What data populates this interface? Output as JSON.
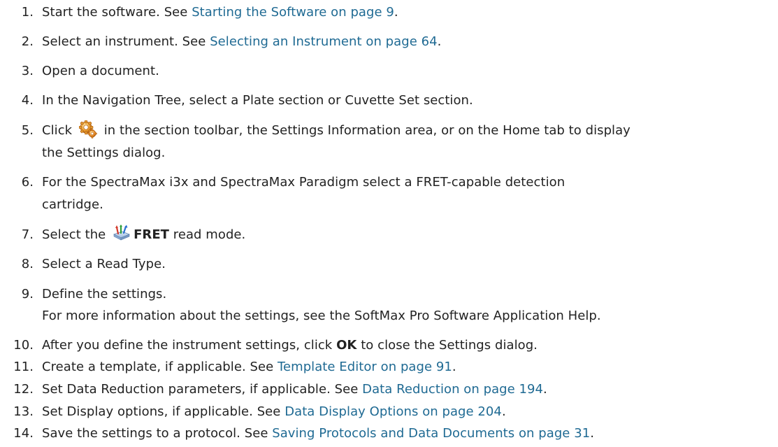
{
  "steps": [
    {
      "num": "1.",
      "text": "Start the software. See ",
      "link": "Starting the Software on page 9",
      "after": "."
    },
    {
      "num": "2.",
      "text": "Select an instrument. See ",
      "link": "Selecting an Instrument on page 64",
      "after": "."
    },
    {
      "num": "3.",
      "text": "Open a document."
    },
    {
      "num": "4.",
      "text": "In the Navigation Tree, select a Plate section or Cuvette Set section."
    },
    {
      "num": "5.",
      "before": "Click ",
      "after": " in the section toolbar, the Settings Information area, or on the Home tab to display",
      "line2": "the Settings dialog.",
      "icon": "settings-gear-icon"
    },
    {
      "num": "6.",
      "text": "For the SpectraMax i3x and SpectraMax Paradigm select a FRET-capable detection",
      "line2": "cartridge."
    },
    {
      "num": "7.",
      "before": "Select the ",
      "bold": "FRET",
      "after": " read mode.",
      "icon": "fret-read-mode-icon"
    },
    {
      "num": "8.",
      "text": "Select a Read Type."
    },
    {
      "num": "9.",
      "text": "Define the settings.",
      "line2": "For more information about the settings, see the SoftMax Pro Software Application Help."
    },
    {
      "num": "10.",
      "before": "After you define the instrument settings, click ",
      "bold": "OK",
      "after": " to close the Settings dialog."
    },
    {
      "num": "11.",
      "text": "Create a template, if applicable. See ",
      "link": "Template Editor on page 91",
      "after": "."
    },
    {
      "num": "12.",
      "text": "Set Data Reduction parameters, if applicable. See ",
      "link": "Data Reduction on page 194",
      "after": "."
    },
    {
      "num": "13.",
      "text": "Set Display options, if applicable. See ",
      "link": "Data Display Options on page 204",
      "after": "."
    },
    {
      "num": "14.",
      "text": "Save the settings to a protocol. See ",
      "link": "Saving Protocols and Data Documents on page 31",
      "after": "."
    }
  ],
  "colors": {
    "text": "#222222",
    "link": "#1f6a93"
  }
}
